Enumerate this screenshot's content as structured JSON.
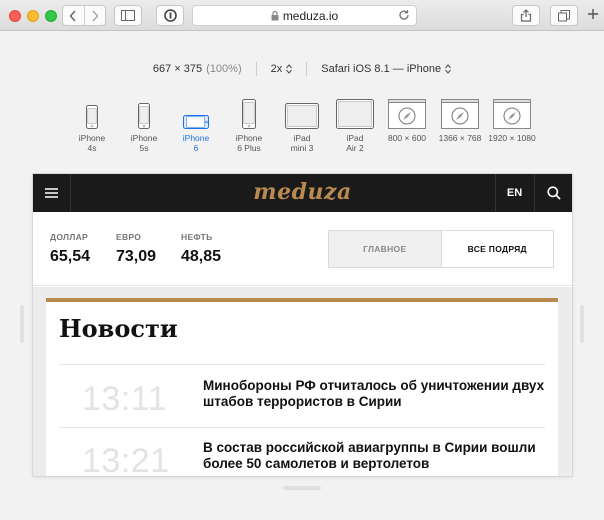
{
  "browser": {
    "url": "meduza.io"
  },
  "responsive": {
    "dimensions": "667 × 375",
    "zoom": "(100%)",
    "scale": "2x",
    "user_agent": "Safari iOS 8.1 — iPhone"
  },
  "devices": [
    {
      "line1": "iPhone",
      "line2": "4s"
    },
    {
      "line1": "iPhone",
      "line2": "5s"
    },
    {
      "line1": "iPhone",
      "line2": "6"
    },
    {
      "line1": "iPhone",
      "line2": "6 Plus"
    },
    {
      "line1": "iPad",
      "line2": "mini 3"
    },
    {
      "line1": "iPad",
      "line2": "Air 2"
    },
    {
      "line1": "800 × 600",
      "line2": ""
    },
    {
      "line1": "1366 × 768",
      "line2": ""
    },
    {
      "line1": "1920 × 1080",
      "line2": ""
    }
  ],
  "site": {
    "logo": "meduza",
    "lang": "EN",
    "rates": [
      {
        "label": "ДОЛЛАР",
        "value": "65,54"
      },
      {
        "label": "ЕВРО",
        "value": "73,09"
      },
      {
        "label": "НЕФТЬ",
        "value": "48,85"
      }
    ],
    "tabs": [
      "ГЛАВНОЕ",
      "ВСЕ ПОДРЯД"
    ],
    "news_heading": "Новости",
    "news": [
      {
        "time": "13:11",
        "title": "Минобороны РФ отчиталось об уничтожении двух штабов террористов в Сирии"
      },
      {
        "time": "13:21",
        "title": "В состав российской авиагруппы в Сирии вошли более 50 самолетов и вертолетов"
      }
    ]
  },
  "colors": {
    "accent": "#b88a4f",
    "active_device": "#1a73e8",
    "header_bg": "#1a1a1a"
  }
}
